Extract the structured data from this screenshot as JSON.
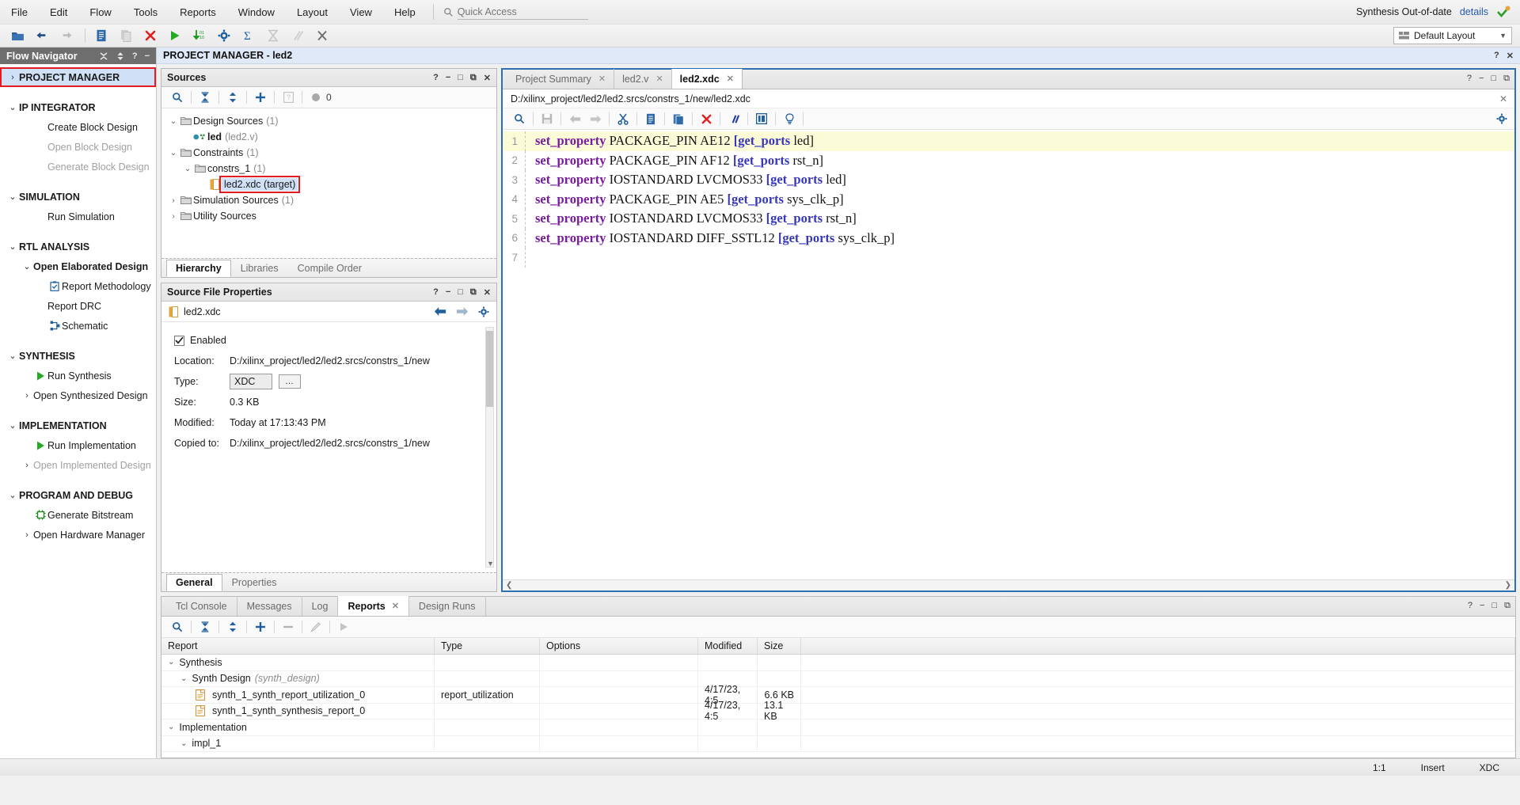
{
  "menu": {
    "items": [
      "File",
      "Edit",
      "Flow",
      "Tools",
      "Reports",
      "Window",
      "Layout",
      "View",
      "Help"
    ],
    "quick_access_placeholder": "Quick Access",
    "status_text": "Synthesis Out-of-date",
    "status_link": "details"
  },
  "toolbar": {
    "layout_value": "Default Layout",
    "icons": [
      "open-project-icon",
      "undo-icon",
      "redo-icon",
      "report-icon",
      "copy-icon",
      "close-icon",
      "run-icon",
      "binary-icon",
      "settings-icon",
      "sum-icon",
      "timing-icon",
      "waveform-icon",
      "cross-probe-icon"
    ]
  },
  "flow_navigator": {
    "title": "Flow Navigator",
    "items": [
      {
        "label": "PROJECT MANAGER",
        "level": 1,
        "bold": true,
        "chevron": "›",
        "selected": true,
        "highlight": true
      },
      {
        "label": "IP INTEGRATOR",
        "level": 1,
        "bold": true,
        "chevron": "⌄",
        "gap_before": true
      },
      {
        "label": "Create Block Design",
        "level": 3
      },
      {
        "label": "Open Block Design",
        "level": 3,
        "disabled": true
      },
      {
        "label": "Generate Block Design",
        "level": 3,
        "disabled": true
      },
      {
        "label": "SIMULATION",
        "level": 1,
        "bold": true,
        "chevron": "⌄",
        "gap_before": true
      },
      {
        "label": "Run Simulation",
        "level": 3
      },
      {
        "label": "RTL ANALYSIS",
        "level": 1,
        "bold": true,
        "chevron": "⌄",
        "gap_before": true
      },
      {
        "label": "Open Elaborated Design",
        "level": 2,
        "bold": true,
        "chevron": "⌄"
      },
      {
        "label": "Report Methodology",
        "level": 3,
        "icon": "clipboard-check-icon"
      },
      {
        "label": "Report DRC",
        "level": 3
      },
      {
        "label": "Schematic",
        "level": 3,
        "icon": "schematic-icon"
      },
      {
        "label": "SYNTHESIS",
        "level": 1,
        "bold": true,
        "chevron": "⌄",
        "gap_before": true
      },
      {
        "label": "Run Synthesis",
        "level": 2,
        "icon": "play-green-icon"
      },
      {
        "label": "Open Synthesized Design",
        "level": 2,
        "chevron": "›"
      },
      {
        "label": "IMPLEMENTATION",
        "level": 1,
        "bold": true,
        "chevron": "⌄",
        "gap_before": true
      },
      {
        "label": "Run Implementation",
        "level": 2,
        "icon": "play-green-icon"
      },
      {
        "label": "Open Implemented Design",
        "level": 2,
        "chevron": "›",
        "disabled": true
      },
      {
        "label": "PROGRAM AND DEBUG",
        "level": 1,
        "bold": true,
        "chevron": "⌄",
        "gap_before": true
      },
      {
        "label": "Generate Bitstream",
        "level": 2,
        "icon": "bitstream-icon"
      },
      {
        "label": "Open Hardware Manager",
        "level": 2,
        "chevron": "›"
      }
    ]
  },
  "project_manager": {
    "title": "PROJECT MANAGER - led2"
  },
  "sources": {
    "title": "Sources",
    "badge_count": "0",
    "tree": [
      {
        "label": "Design Sources",
        "count": "(1)",
        "indent": 0,
        "chevron": "⌄",
        "icon": "folder-icon"
      },
      {
        "label": "led",
        "sub": "(led2.v)",
        "indent": 1,
        "icon": "module-icon",
        "bold": true
      },
      {
        "label": "Constraints",
        "count": "(1)",
        "indent": 0,
        "chevron": "⌄",
        "icon": "folder-icon"
      },
      {
        "label": "constrs_1",
        "count": "(1)",
        "indent": 1,
        "chevron": "⌄",
        "icon": "folder-icon"
      },
      {
        "label": "led2.xdc (target)",
        "indent": 2,
        "icon": "xdc-file-icon",
        "selected": true,
        "highlight": true
      },
      {
        "label": "Simulation Sources",
        "count": "(1)",
        "indent": 0,
        "chevron": "›",
        "icon": "folder-icon"
      },
      {
        "label": "Utility Sources",
        "indent": 0,
        "chevron": "›",
        "icon": "folder-icon"
      }
    ],
    "tabs": [
      {
        "label": "Hierarchy",
        "active": true
      },
      {
        "label": "Libraries",
        "active": false
      },
      {
        "label": "Compile Order",
        "active": false
      }
    ]
  },
  "source_file_properties": {
    "title": "Source File Properties",
    "file_name": "led2.xdc",
    "enabled_label": "Enabled",
    "rows": [
      {
        "label": "Location:",
        "value": "D:/xilinx_project/led2/led2.srcs/constrs_1/new"
      },
      {
        "label": "Type:",
        "value": "XDC",
        "is_select": true,
        "dots": "…"
      },
      {
        "label": "Size:",
        "value": "0.3 KB"
      },
      {
        "label": "Modified:",
        "value": "Today at 17:13:43 PM"
      },
      {
        "label": "Copied to:",
        "value": "D:/xilinx_project/led2/led2.srcs/constrs_1/new"
      }
    ],
    "tabs": [
      {
        "label": "General",
        "active": true
      },
      {
        "label": "Properties",
        "active": false
      }
    ]
  },
  "editor": {
    "tabs": [
      {
        "label": "Project Summary",
        "active": false,
        "closable": true
      },
      {
        "label": "led2.v",
        "active": false,
        "closable": true
      },
      {
        "label": "led2.xdc",
        "active": true,
        "closable": true
      }
    ],
    "file_path": "D:/xilinx_project/led2/led2.srcs/constrs_1/new/led2.xdc",
    "toolbar_icons": [
      "search-icon",
      "save-icon",
      "undo-icon",
      "redo-icon",
      "cut-icon",
      "copy-icon",
      "paste-icon",
      "delete-icon",
      "comment-icon",
      "indent-icon",
      "bulb-icon"
    ],
    "lines": [
      {
        "n": "1",
        "highlight": true,
        "tokens": [
          {
            "t": "set_property",
            "c": "kw"
          },
          {
            "t": " PACKAGE_PIN AE12 ",
            "c": "plain"
          },
          {
            "t": "[get_ports",
            "c": "br"
          },
          {
            "t": " led]",
            "c": "plain"
          }
        ]
      },
      {
        "n": "2",
        "tokens": [
          {
            "t": "set_property",
            "c": "kw"
          },
          {
            "t": " PACKAGE_PIN AF12 ",
            "c": "plain"
          },
          {
            "t": "[get_ports",
            "c": "br"
          },
          {
            "t": " rst_n]",
            "c": "plain"
          }
        ]
      },
      {
        "n": "3",
        "tokens": [
          {
            "t": "set_property",
            "c": "kw"
          },
          {
            "t": " IOSTANDARD LVCMOS33 ",
            "c": "plain"
          },
          {
            "t": "[get_ports",
            "c": "br"
          },
          {
            "t": " led]",
            "c": "plain"
          }
        ]
      },
      {
        "n": "4",
        "tokens": [
          {
            "t": "set_property",
            "c": "kw"
          },
          {
            "t": " PACKAGE_PIN AE5 ",
            "c": "plain"
          },
          {
            "t": "[get_ports",
            "c": "br"
          },
          {
            "t": " sys_clk_p]",
            "c": "plain"
          }
        ]
      },
      {
        "n": "5",
        "tokens": [
          {
            "t": "set_property",
            "c": "kw"
          },
          {
            "t": " IOSTANDARD LVCMOS33 ",
            "c": "plain"
          },
          {
            "t": "[get_ports",
            "c": "br"
          },
          {
            "t": " rst_n]",
            "c": "plain"
          }
        ]
      },
      {
        "n": "6",
        "tokens": [
          {
            "t": "set_property",
            "c": "kw"
          },
          {
            "t": " IOSTANDARD DIFF_SSTL12 ",
            "c": "plain"
          },
          {
            "t": "[get_ports",
            "c": "br"
          },
          {
            "t": " sys_clk_p]",
            "c": "plain"
          }
        ]
      },
      {
        "n": "7",
        "tokens": []
      }
    ]
  },
  "bottom_panel": {
    "tabs": [
      {
        "label": "Tcl Console",
        "active": false
      },
      {
        "label": "Messages",
        "active": false
      },
      {
        "label": "Log",
        "active": false
      },
      {
        "label": "Reports",
        "active": true,
        "closable": true
      },
      {
        "label": "Design Runs",
        "active": false
      }
    ],
    "toolbar_icons": [
      "search-icon",
      "collapse-icon",
      "expand-icon",
      "add-icon",
      "remove-icon",
      "edit-icon",
      "run-icon"
    ],
    "columns": [
      "Report",
      "Type",
      "Options",
      "Modified",
      "Size"
    ],
    "rows": [
      {
        "cells": [
          "Synthesis",
          "",
          "",
          "",
          ""
        ],
        "indent": 0,
        "chevron": "⌄",
        "kind": "group"
      },
      {
        "cells": [
          "Synth Design",
          "",
          "",
          "",
          ""
        ],
        "sub": "(synth_design)",
        "indent": 1,
        "chevron": "⌄",
        "kind": "group"
      },
      {
        "cells": [
          "synth_1_synth_report_utilization_0",
          "report_utilization",
          "",
          "4/17/23, 4:5",
          "6.6 KB"
        ],
        "indent": 2,
        "icon": "report-file-icon",
        "kind": "item"
      },
      {
        "cells": [
          "synth_1_synth_synthesis_report_0",
          "",
          "",
          "4/17/23, 4:5",
          "13.1 KB"
        ],
        "indent": 2,
        "icon": "report-file-icon",
        "kind": "item"
      },
      {
        "cells": [
          "Implementation",
          "",
          "",
          "",
          ""
        ],
        "indent": 0,
        "chevron": "⌄",
        "kind": "group"
      },
      {
        "cells": [
          "impl_1",
          "",
          "",
          "",
          ""
        ],
        "indent": 1,
        "chevron": "⌄",
        "kind": "group"
      }
    ]
  },
  "statusbar": {
    "zoom": "1:1",
    "mode": "Insert",
    "filetype": "XDC"
  }
}
